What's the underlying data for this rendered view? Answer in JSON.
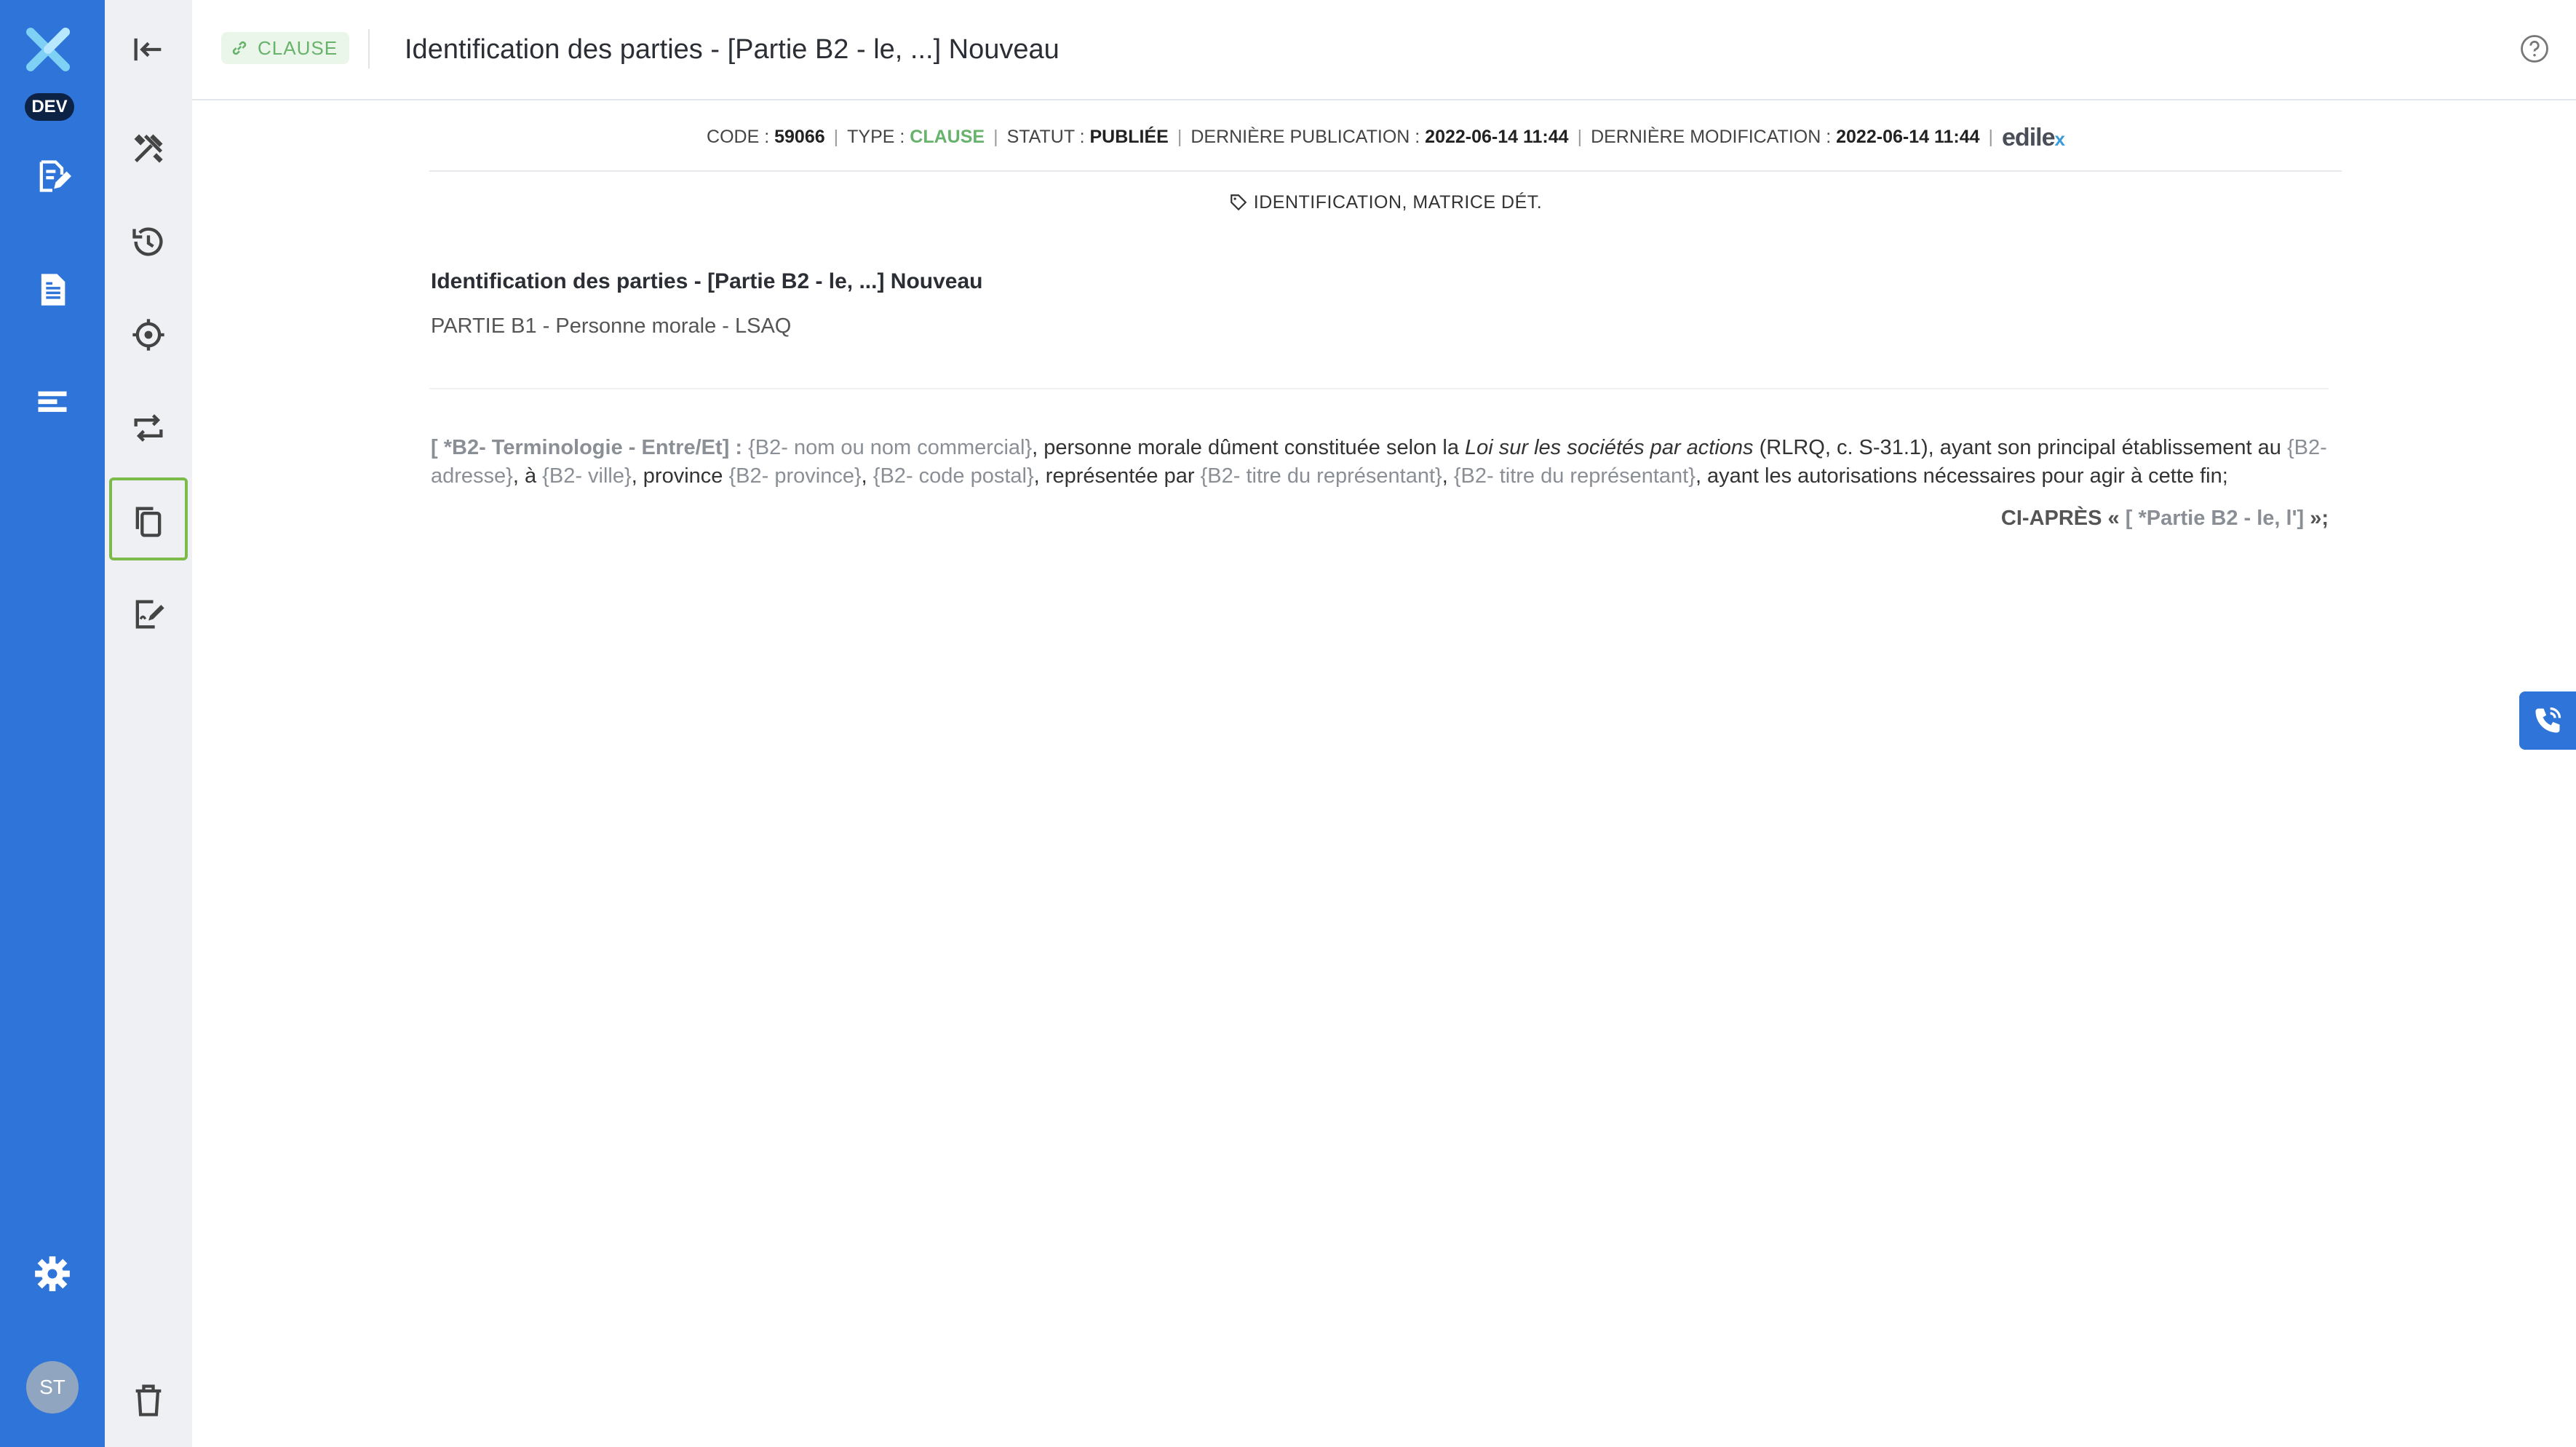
{
  "sidebar": {
    "env_badge": "DEV",
    "avatar_initials": "ST",
    "accent_color": "#2f74d8",
    "items": [
      {
        "icon": "document-edit-icon"
      },
      {
        "icon": "document-icon"
      },
      {
        "icon": "align-left-icon"
      },
      {
        "icon": "gear-icon"
      }
    ]
  },
  "toolbar": {
    "items": [
      {
        "icon": "collapse-left-icon"
      },
      {
        "icon": "tools-icon"
      },
      {
        "icon": "history-icon"
      },
      {
        "icon": "target-icon"
      },
      {
        "icon": "swap-icon"
      },
      {
        "icon": "copy-icon",
        "selected": true
      },
      {
        "icon": "signature-edit-icon"
      },
      {
        "icon": "trash-icon"
      }
    ]
  },
  "header": {
    "badge": "CLAUSE",
    "title": "Identification des parties - [Partie B2 - le, ...] Nouveau"
  },
  "meta": {
    "code_label": "CODE : ",
    "code_value": "59066",
    "type_label": "TYPE : ",
    "type_value": "CLAUSE",
    "status_label": "STATUT : ",
    "status_value": "PUBLIÉE",
    "published_label": "DERNIÈRE PUBLICATION : ",
    "published_value": "2022-06-14 11:44",
    "modified_label": "DERNIÈRE MODIFICATION : ",
    "modified_value": "2022-06-14 11:44",
    "brand": "edile",
    "brand_mark": "x"
  },
  "tags": "IDENTIFICATION, MATRICE DÉT.",
  "content": {
    "title": "Identification des parties - [Partie B2 - le, ...] Nouveau",
    "subtitle": "PARTIE B1 - Personne morale - LSAQ",
    "p_label": " [ *B2- Terminologie - Entre/Et] : ",
    "p_ph1": "{B2- nom ou nom commercial}",
    "p_t1": ", personne morale dûment constituée selon la ",
    "p_law": "Loi sur les sociétés par actions",
    "p_t2": " (RLRQ, c. S-31.1), ayant son principal établissement au ",
    "p_ph2": "{B2- adresse}",
    "p_t3": ", à ",
    "p_ph3": "{B2- ville}",
    "p_t4": ", province ",
    "p_ph4": "{B2- province}",
    "p_t5": ", ",
    "p_ph5": "{B2- code postal}",
    "p_t6": ", représentée par ",
    "p_ph6": "{B2- titre du représentant}",
    "p_t7": ", ",
    "p_ph7": "{B2- titre du représentant}",
    "p_t8": ", ayant les autorisations nécessaires pour agir à cette fin;",
    "ci_prefix": "CI-APRÈS « ",
    "ci_ph": "[ *Partie B2 - le, l']",
    "ci_suffix": " »;"
  },
  "phone_icon": "phone-icon"
}
